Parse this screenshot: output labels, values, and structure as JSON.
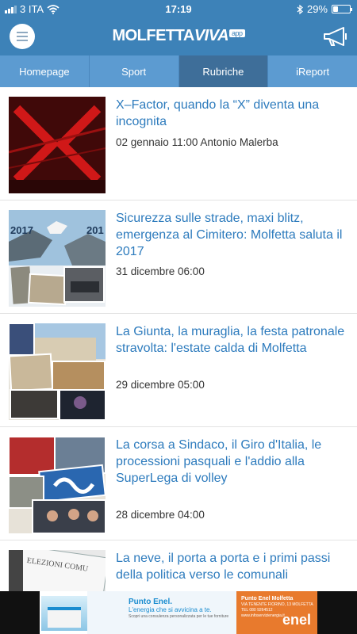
{
  "status": {
    "carrier": "3 ITA",
    "time": "17:19",
    "battery": "29%",
    "battery_level": 0.29
  },
  "header": {
    "logo_main": "MOLFETTA",
    "logo_accent": "VIVA",
    "logo_tag": "app"
  },
  "tabs": [
    {
      "label": "Homepage"
    },
    {
      "label": "Sport"
    },
    {
      "label": "Rubriche"
    },
    {
      "label": "iReport"
    }
  ],
  "articles": [
    {
      "title": "X–Factor, quando la “X” diventa una incognita",
      "meta": "02 gennaio 11:00 Antonio Malerba"
    },
    {
      "title": "Sicurezza sulle strade, maxi blitz, emergenza al Cimitero: Molfetta saluta il 2017",
      "meta": "31 dicembre 06:00"
    },
    {
      "title": "La Giunta, la muraglia, la festa patronale stravolta: l'estate calda di Molfetta",
      "meta": "29 dicembre 05:00"
    },
    {
      "title": "La corsa a Sindaco, il Giro d'Italia, le processioni pasquali e l'addio alla SuperLega di volley",
      "meta": "28 dicembre 04:00"
    },
    {
      "title": "La neve, il porta a porta e i primi passi della politica verso le comunali",
      "meta": ""
    }
  ],
  "thumb_text": {
    "year_left": "2017",
    "year_right": "201",
    "elections": "ELEZIONI COMU"
  },
  "ad": {
    "brand": "Punto Enel.",
    "tagline": "L'energia che si avvicina a te.",
    "small_text": "Scopri una consulenza personalizzata per le tue forniture",
    "store_name": "Punto Enel Molfetta",
    "store_address": "VIA TENENTE FIORINO, 13 MOLFETTA",
    "store_phone": "TEL 080 9264512",
    "store_web": "www.infoservizienergia.it",
    "logo": "enel"
  }
}
